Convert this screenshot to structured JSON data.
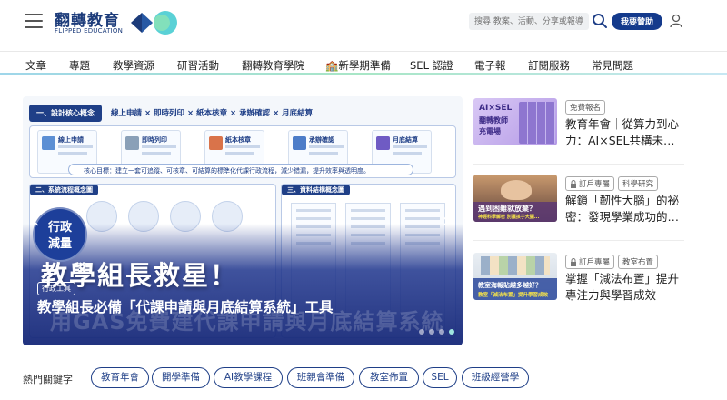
{
  "header": {
    "logo_title": "翻轉教育",
    "logo_subtitle": "FLIPPED EDUCATION",
    "search_placeholder": "搜尋 教案、活動、分享或報導",
    "donate_label": "我要贊助",
    "icons": [
      "hamburger-icon",
      "search-icon",
      "user-icon"
    ],
    "brand_color": "#143a8c"
  },
  "nav": {
    "items": [
      "文章",
      "專題",
      "教學資源",
      "研習活動",
      "翻轉教育學院",
      "🏫新學期準備",
      "SEL 認證",
      "電子報",
      "訂閱服務",
      "常見問題"
    ]
  },
  "hero": {
    "strip_label": "一、設計核心概念",
    "strip_flow": "線上申請 × 即時列印 × 紙本核章 × 承辦確認 × 月底結算",
    "cards": [
      "線上申請",
      "即時列印",
      "紙本核章",
      "承辦確認",
      "月底結算"
    ],
    "goal_text": "核心目標：建立一套可追蹤、可核章、可結算的標準化代課行政流程，減少錯漏，提升效率與透明度。",
    "left_diagram_head": "二、系統流程概念圖",
    "right_diagram_head": "三、資料結構概念圖",
    "tag_circle": "行政\n減量",
    "tag_line1": "行政",
    "tag_line2": "減量",
    "big_text": "教學組長救星！",
    "ghost_text": "用GAS免費建代課申請與月底結算系統",
    "badge": "行政工具",
    "headline": "教學組長必備「代課申請與月底結算系統」工具",
    "prev_icon": "chevron-left-icon",
    "next_icon": "chevron-right-icon",
    "slides_count": 4,
    "active_slide": 3
  },
  "side_cards": [
    {
      "thumb_lines": [
        "AI×SEL",
        "翻轉教師",
        "充電場"
      ],
      "tags": [
        {
          "label": "免費報名",
          "icon": ""
        }
      ],
      "title": "教育年會｜從算力到心力：AI×SEL共構未…"
    },
    {
      "thumb_lines": [
        "遇到困難就放棄？",
        "神經科學解密 別讓孩子大腦..."
      ],
      "tags": [
        {
          "label": "訂戶專屬",
          "icon": "lock-icon"
        },
        {
          "label": "科學研究",
          "icon": ""
        }
      ],
      "title": "解鎖「韌性大腦」的祕密：發現學業成功的…"
    },
    {
      "thumb_lines": [
        "教室海報貼越多越好？",
        "教室「減法布置」提升學習成效"
      ],
      "tags": [
        {
          "label": "訂戶專屬",
          "icon": "lock-icon"
        },
        {
          "label": "教室布置",
          "icon": ""
        }
      ],
      "title": "掌握「減法布置」提升專注力與學習成效"
    }
  ],
  "hot_keywords": {
    "label": "熱門關鍵字",
    "items": [
      "教育年會",
      "開學準備",
      "AI教學課程",
      "班親會準備",
      "教室佈置",
      "SEL",
      "班級經營學"
    ]
  }
}
